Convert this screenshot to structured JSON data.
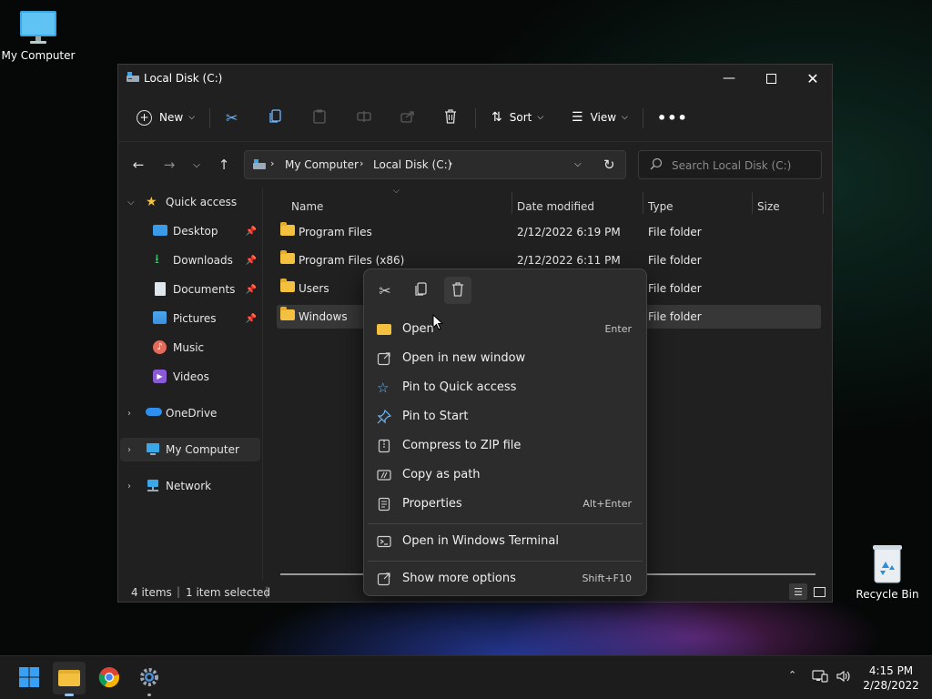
{
  "desktop": {
    "my_computer_label": "My Computer",
    "recycle_bin_label": "Recycle Bin"
  },
  "window": {
    "title": "Local Disk (C:)"
  },
  "toolbar": {
    "new_label": "New",
    "sort_label": "Sort",
    "view_label": "View"
  },
  "address": {
    "crumbs": [
      "My Computer",
      "Local Disk (C:)"
    ],
    "search_placeholder": "Search Local Disk (C:)"
  },
  "sidebar": {
    "quick_access": "Quick access",
    "items": [
      "Desktop",
      "Downloads",
      "Documents",
      "Pictures",
      "Music",
      "Videos"
    ],
    "onedrive": "OneDrive",
    "my_computer": "My Computer",
    "network": "Network"
  },
  "columns": {
    "name": "Name",
    "date": "Date modified",
    "type": "Type",
    "size": "Size"
  },
  "files": [
    {
      "name": "Program Files",
      "date": "2/12/2022 6:19 PM",
      "type": "File folder"
    },
    {
      "name": "Program Files (x86)",
      "date": "2/12/2022 6:11 PM",
      "type": "File folder"
    },
    {
      "name": "Users",
      "date": "",
      "type": "File folder"
    },
    {
      "name": "Windows",
      "date": "",
      "type": "File folder"
    }
  ],
  "status": {
    "items": "4 items",
    "selected": "1 item selected"
  },
  "context_menu": {
    "items": [
      {
        "label": "Open",
        "key": "Enter"
      },
      {
        "label": "Open in new window",
        "key": ""
      },
      {
        "label": "Pin to Quick access",
        "key": ""
      },
      {
        "label": "Pin to Start",
        "key": ""
      },
      {
        "label": "Compress to ZIP file",
        "key": ""
      },
      {
        "label": "Copy as path",
        "key": ""
      },
      {
        "label": "Properties",
        "key": "Alt+Enter"
      },
      {
        "label": "Open in Windows Terminal",
        "key": ""
      },
      {
        "label": "Show more options",
        "key": "Shift+F10"
      }
    ]
  },
  "taskbar": {
    "time": "4:15 PM",
    "date": "2/28/2022"
  },
  "colors": {
    "folder": "#f3c040",
    "accent": "#0078d4",
    "window_bg": "#202020",
    "menu_bg": "#2c2c2c"
  }
}
